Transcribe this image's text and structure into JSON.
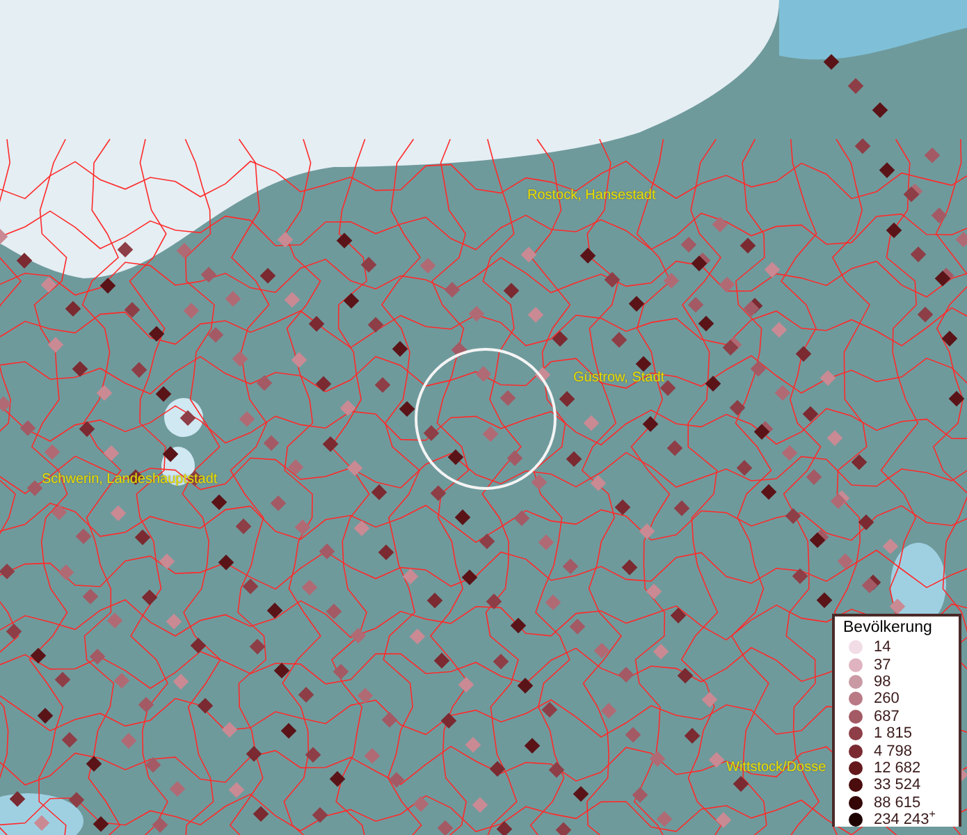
{
  "map": {
    "places": [
      {
        "name": "Rostock, Hansestadt"
      },
      {
        "name": "Güstrow, Stadt"
      },
      {
        "name": "Schwerin, Landeshauptstadt"
      },
      {
        "name": "Wittstock/Dosse"
      }
    ]
  },
  "legend": {
    "title": "Bevölkerung",
    "entries": [
      {
        "label": "14",
        "color": "#f2dce6"
      },
      {
        "label": "37",
        "color": "#dfb3bf"
      },
      {
        "label": "98",
        "color": "#c99aa4"
      },
      {
        "label": "260",
        "color": "#b97a86"
      },
      {
        "label": "687",
        "color": "#a35a64"
      },
      {
        "label": "1 815",
        "color": "#8e3e46"
      },
      {
        "label": "4 798",
        "color": "#7a2a30"
      },
      {
        "label": "12 682",
        "color": "#64181c"
      },
      {
        "label": "33 524",
        "color": "#4a0c0c"
      },
      {
        "label": "88 615",
        "color": "#340606"
      },
      {
        "label": "234 243$^{+}$",
        "color": "#1e0303"
      }
    ]
  }
}
